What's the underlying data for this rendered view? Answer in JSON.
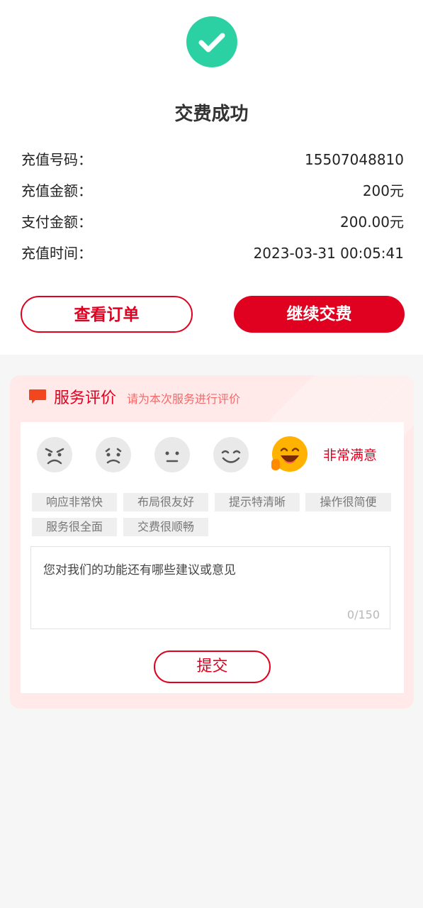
{
  "header": {
    "title": "交费成功"
  },
  "info": [
    {
      "label": "充值号码：",
      "value": "15507048810"
    },
    {
      "label": "充值金额：",
      "value": "200元"
    },
    {
      "label": "支付金额：",
      "value": "200.00元"
    },
    {
      "label": "充值时间：",
      "value": "2023-03-31 00:05:41"
    }
  ],
  "actions": {
    "view_order": "查看订单",
    "continue_pay": "继续交费"
  },
  "evaluation": {
    "title": "服务评价",
    "subtitle": "请为本次服务进行评价",
    "selected_label": "非常满意",
    "tags": [
      "响应非常快",
      "布局很友好",
      "提示特清晰",
      "操作很简便",
      "服务很全面",
      "交费很顺畅"
    ],
    "placeholder": "您对我们的功能还有哪些建议或意见",
    "counter": "0/150",
    "submit": "提交"
  },
  "colors": {
    "accent": "#e0001f",
    "success": "#2bd1a3"
  }
}
